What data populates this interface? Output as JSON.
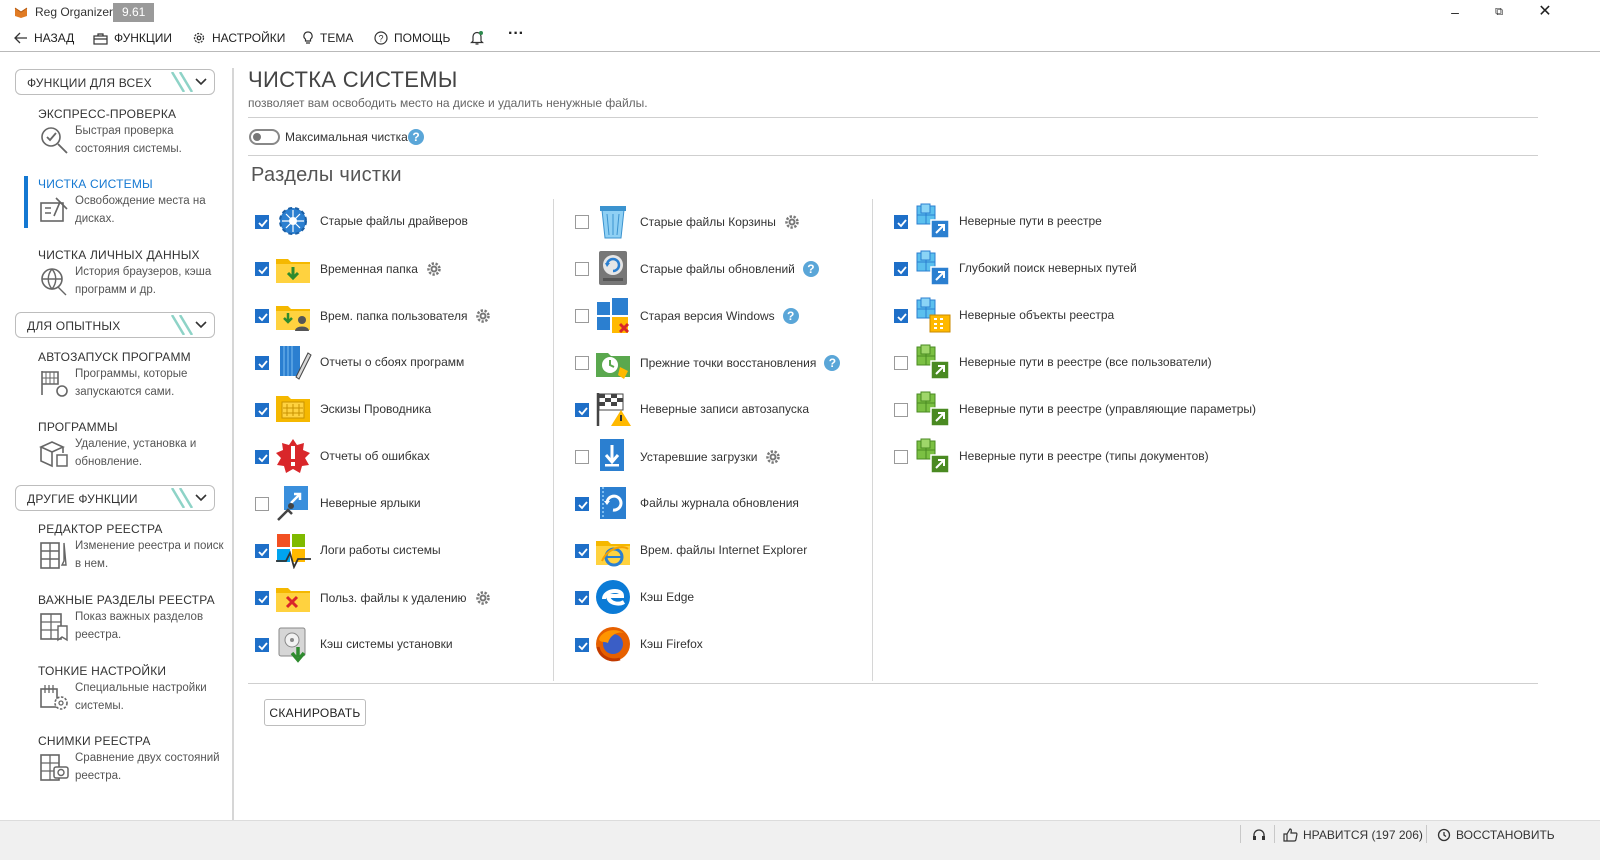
{
  "app": {
    "title": "Reg Organizer",
    "version": "9.61",
    "accent_color": "#1478d2",
    "checkbox_color": "#1e6fc8"
  },
  "toolbar": {
    "back": "НАЗАД",
    "functions": "ФУНКЦИИ",
    "settings": "НАСТРОЙКИ",
    "theme": "ТЕМА",
    "help": "ПОМОЩЬ",
    "more": "···"
  },
  "sidebar": {
    "groups": [
      {
        "label": "ФУНКЦИИ ДЛЯ ВСЕХ"
      },
      {
        "label": "ДЛЯ ОПЫТНЫХ"
      },
      {
        "label": "ДРУГИЕ ФУНКЦИИ"
      }
    ],
    "items": [
      {
        "title": "ЭКСПРЕСС-ПРОВЕРКА",
        "desc": "Быстрая проверка состояния системы.",
        "icon": "express-check-icon",
        "active": false
      },
      {
        "title": "ЧИСТКА СИСТЕМЫ",
        "desc": "Освобождение места на дисках.",
        "icon": "system-cleanup-icon",
        "active": true
      },
      {
        "title": "ЧИСТКА ЛИЧНЫХ ДАННЫХ",
        "desc": "История браузеров, кэша программ и др.",
        "icon": "personal-data-icon",
        "active": false
      },
      {
        "title": "АВТОЗАПУСК ПРОГРАММ",
        "desc": "Программы, которые запускаются сами.",
        "icon": "autorun-icon",
        "active": false
      },
      {
        "title": "ПРОГРАММЫ",
        "desc": "Удаление, установка и обновление.",
        "icon": "programs-icon",
        "active": false
      },
      {
        "title": "РЕДАКТОР РЕЕСТРА",
        "desc": "Изменение реестра и поиск в нем.",
        "icon": "registry-editor-icon",
        "active": false
      },
      {
        "title": "ВАЖНЫЕ РАЗДЕЛЫ РЕЕСТРА",
        "desc": "Показ важных разделов реестра.",
        "icon": "important-keys-icon",
        "active": false
      },
      {
        "title": "ТОНКИЕ НАСТРОЙКИ",
        "desc": "Специальные настройки системы.",
        "icon": "tweaks-icon",
        "active": false
      },
      {
        "title": "СНИМКИ РЕЕСТРА",
        "desc": "Сравнение двух состояний реестра.",
        "icon": "registry-snapshots-icon",
        "active": false
      }
    ]
  },
  "main": {
    "title": "ЧИСТКА СИСТЕМЫ",
    "subtitle": "позволяет вам освободить место на диске и удалить ненужные файлы.",
    "max_cleanup_label": "Максимальная чистка",
    "max_cleanup_enabled": false,
    "help_glyph": "?",
    "section_title": "Разделы чистки",
    "scan_button": "СКАНИРОВАТЬ",
    "columns": [
      [
        {
          "label": "Старые файлы драйверов",
          "checked": true,
          "icon": "driver-files-icon",
          "extra": ""
        },
        {
          "label": "Временная папка",
          "checked": true,
          "icon": "temp-folder-icon",
          "extra": "gear"
        },
        {
          "label": "Врем. папка пользователя",
          "checked": true,
          "icon": "user-temp-folder-icon",
          "extra": "gear"
        },
        {
          "label": "Отчеты о сбоях программ",
          "checked": true,
          "icon": "crash-reports-icon",
          "extra": ""
        },
        {
          "label": "Эскизы Проводника",
          "checked": true,
          "icon": "thumbnails-icon",
          "extra": ""
        },
        {
          "label": "Отчеты об ошибках",
          "checked": true,
          "icon": "error-reports-icon",
          "extra": ""
        },
        {
          "label": "Неверные ярлыки",
          "checked": false,
          "icon": "broken-shortcuts-icon",
          "extra": ""
        },
        {
          "label": "Логи работы системы",
          "checked": true,
          "icon": "system-logs-icon",
          "extra": ""
        },
        {
          "label": "Польз. файлы к удалению",
          "checked": true,
          "icon": "user-files-delete-icon",
          "extra": "gear"
        },
        {
          "label": "Кэш системы установки",
          "checked": true,
          "icon": "installer-cache-icon",
          "extra": ""
        }
      ],
      [
        {
          "label": "Старые файлы Корзины",
          "checked": false,
          "icon": "recycle-bin-icon",
          "extra": "gear"
        },
        {
          "label": "Старые файлы обновлений",
          "checked": false,
          "icon": "update-files-icon",
          "extra": "help"
        },
        {
          "label": "Старая версия Windows",
          "checked": false,
          "icon": "old-windows-icon",
          "extra": "help"
        },
        {
          "label": "Прежние точки восстановления",
          "checked": false,
          "icon": "restore-points-icon",
          "extra": "help"
        },
        {
          "label": "Неверные записи автозапуска",
          "checked": true,
          "icon": "autorun-entries-icon",
          "extra": ""
        },
        {
          "label": "Устаревшие загрузки",
          "checked": false,
          "icon": "old-downloads-icon",
          "extra": "gear"
        },
        {
          "label": "Файлы журнала обновления",
          "checked": true,
          "icon": "update-log-icon",
          "extra": ""
        },
        {
          "label": "Врем. файлы Internet Explorer",
          "checked": true,
          "icon": "ie-temp-files-icon",
          "extra": ""
        },
        {
          "label": "Кэш Edge",
          "checked": true,
          "icon": "edge-icon",
          "extra": ""
        },
        {
          "label": "Кэш Firefox",
          "checked": true,
          "icon": "firefox-icon",
          "extra": ""
        }
      ],
      [
        {
          "label": "Неверные пути в реестре",
          "checked": true,
          "icon": "registry-paths-icon",
          "extra": ""
        },
        {
          "label": "Глубокий поиск неверных путей",
          "checked": true,
          "icon": "deep-search-icon",
          "extra": ""
        },
        {
          "label": "Неверные объекты реестра",
          "checked": true,
          "icon": "registry-objects-icon",
          "extra": ""
        },
        {
          "label": "Неверные пути в реестре (все пользователи)",
          "checked": false,
          "icon": "registry-all-users-icon",
          "extra": ""
        },
        {
          "label": "Неверные пути в реестре (управляющие параметры)",
          "checked": false,
          "icon": "registry-control-params-icon",
          "extra": ""
        },
        {
          "label": "Неверные пути в реестре (типы документов)",
          "checked": false,
          "icon": "registry-doc-types-icon",
          "extra": ""
        }
      ]
    ]
  },
  "statusbar": {
    "like": "НРАВИТСЯ (197 206)",
    "restore": "ВОССТАНОВИТЬ"
  }
}
